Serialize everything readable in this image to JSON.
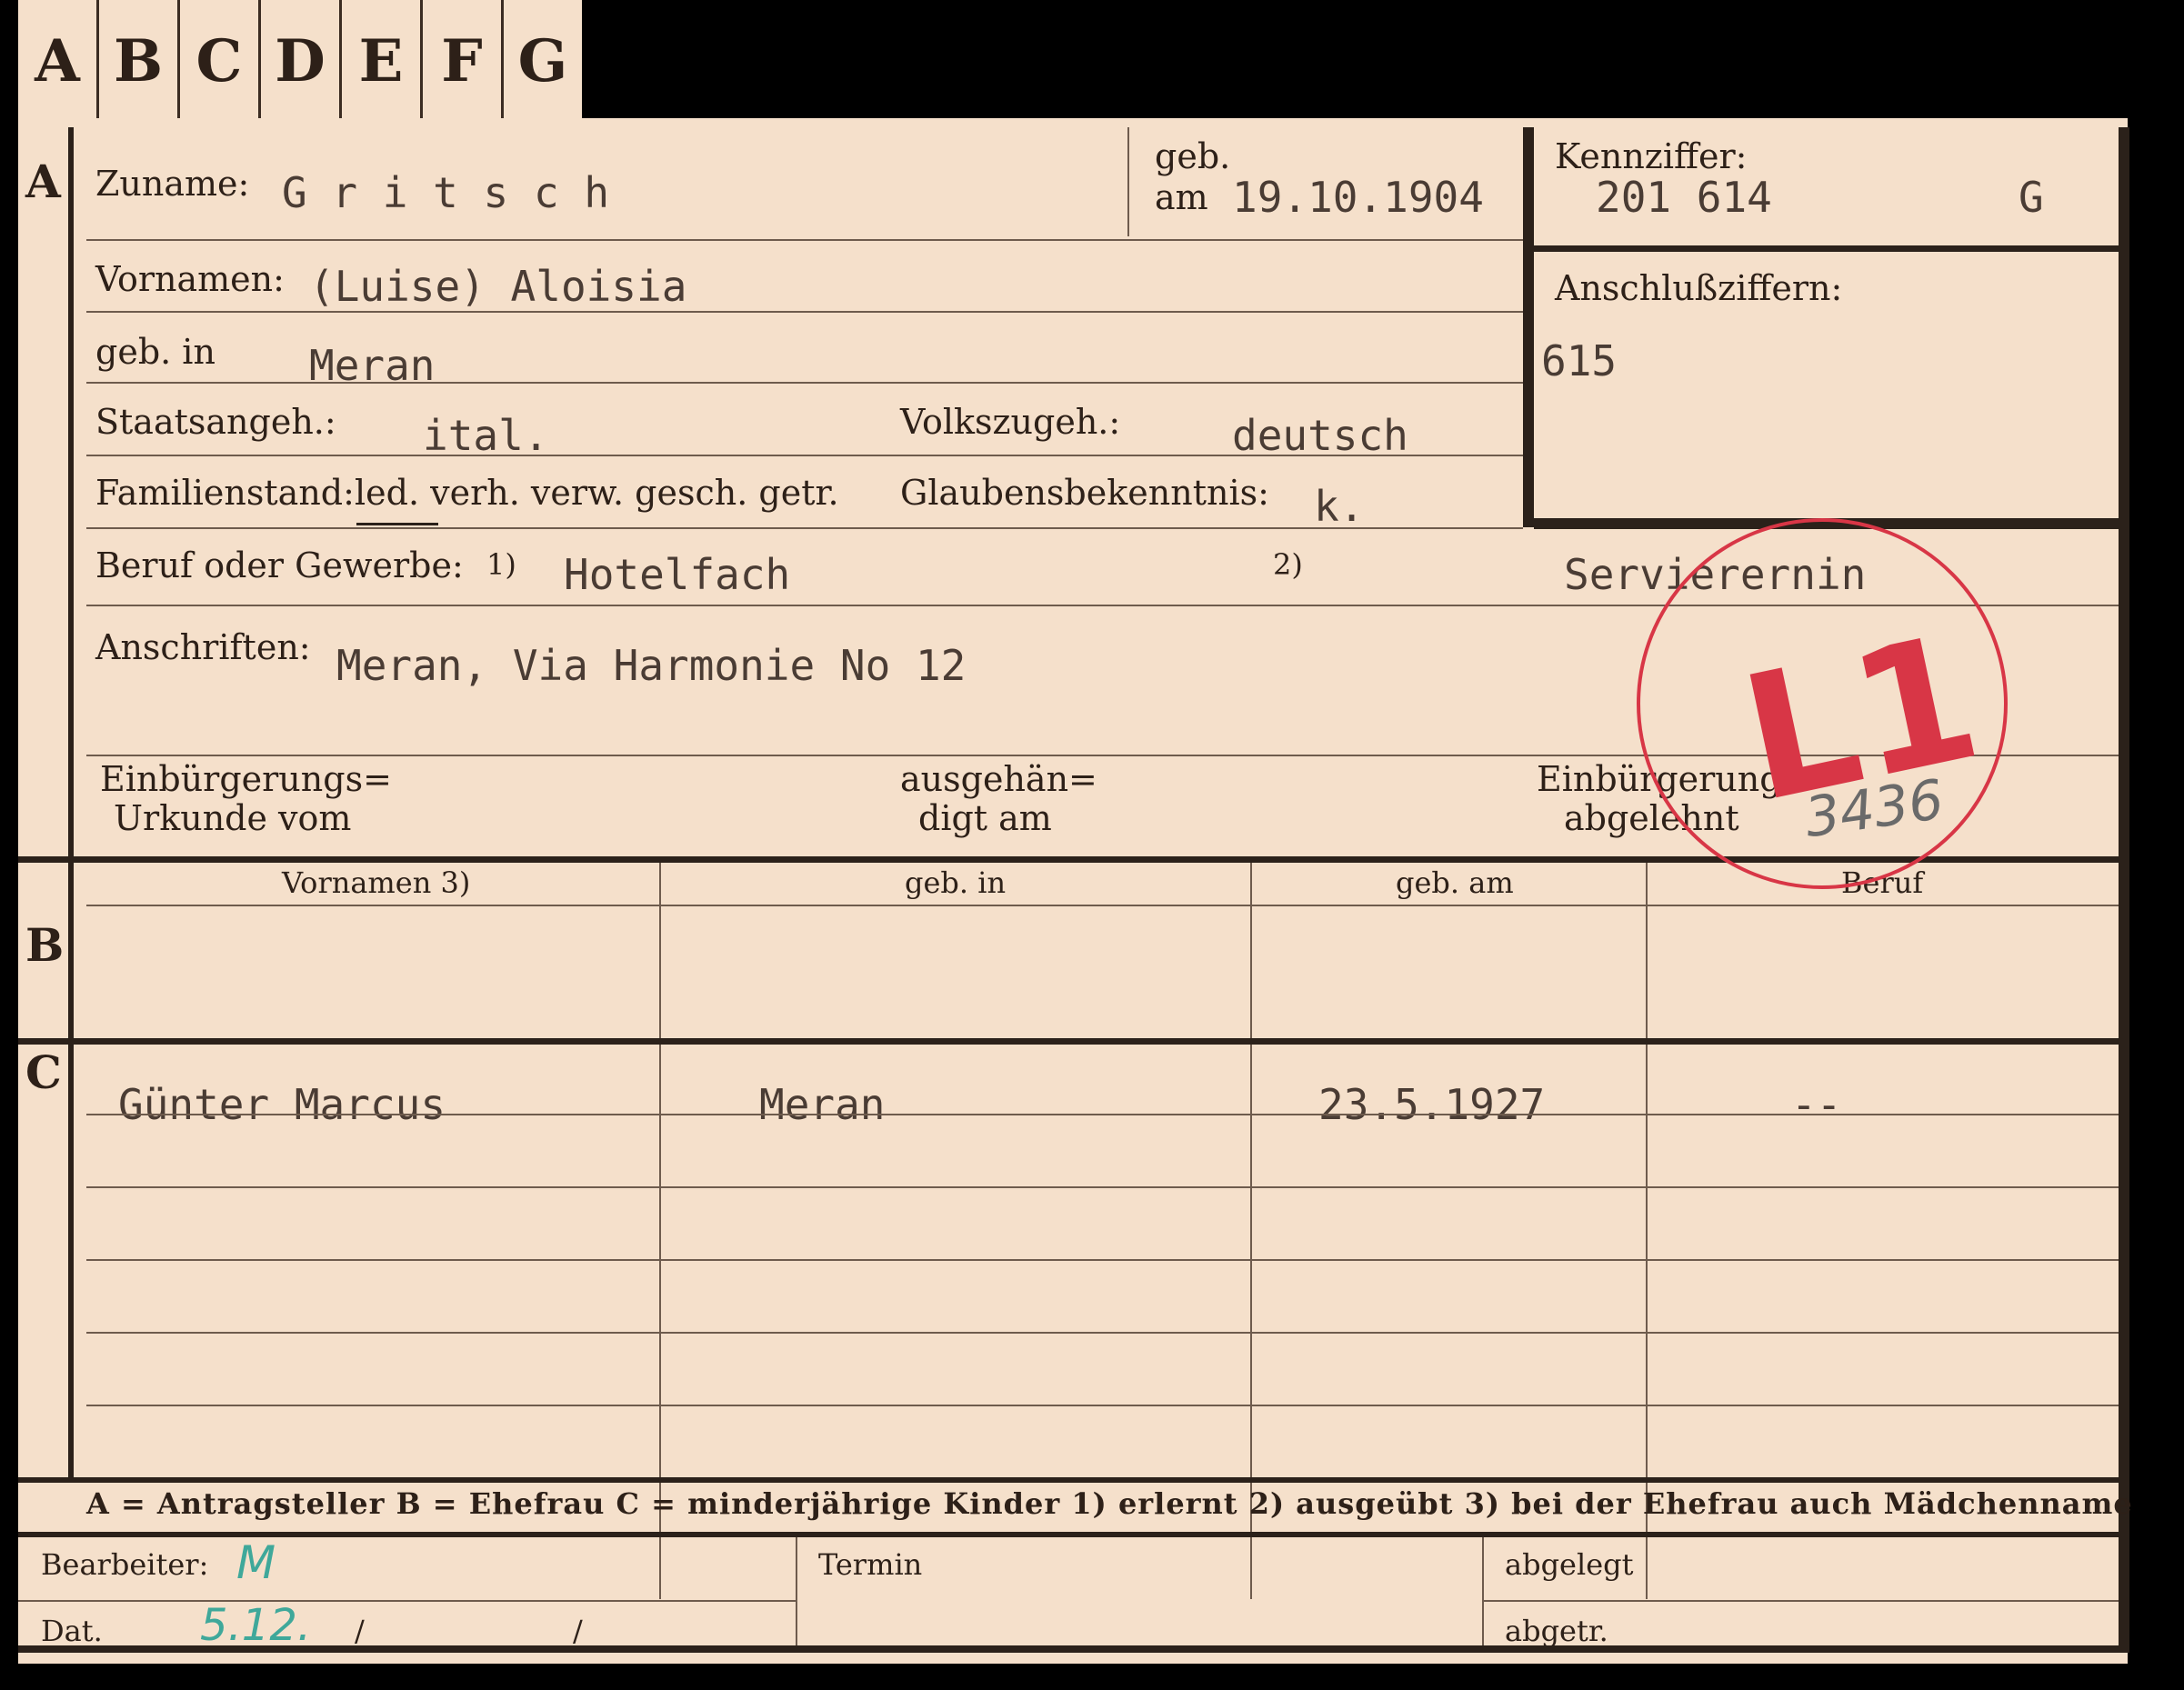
{
  "tabs": [
    "A",
    "B",
    "C",
    "D",
    "E",
    "F",
    "G"
  ],
  "section_letters": {
    "a": "A",
    "b": "B",
    "c": "C"
  },
  "header": {
    "zuname_label": "Zuname:",
    "zuname_value": "G r i t s c h",
    "geb_label": "geb.",
    "am_label": "am",
    "birth_date": "19.10.1904",
    "kennziffer_label": "Kennziffer:",
    "kennziffer_value": "201 614",
    "kennziffer_suffix": "G",
    "anschluss_label": "Anschlußziffern:",
    "anschluss_value": "615"
  },
  "person": {
    "vornamen_label": "Vornamen:",
    "vornamen_value": "(Luise) Aloisia",
    "gebin_label": "geb. in",
    "gebin_value": "Meran",
    "staatsangeh_label": "Staatsangeh.:",
    "staatsangeh_value": "ital.",
    "volkszugeh_label": "Volkszugeh.:",
    "volkszugeh_value": "deutsch",
    "familienstand_label": "Familienstand:",
    "familienstand_options": "led. verh. verw. gesch. getr.",
    "glauben_label": "Glaubensbekenntnis:",
    "glauben_value": "k.",
    "beruf_label": "Beruf oder Gewerbe:",
    "beruf_mark1": "1)",
    "beruf_value1": "Hotelfach",
    "beruf_mark2": "2)",
    "beruf_value2": "Servierernin",
    "anschriften_label": "Anschriften:",
    "anschriften_value": "Meran, Via Harmonie No 12",
    "einb_urkunde_label_1": "Einbürgerungs=",
    "einb_urkunde_label_2": "Urkunde vom",
    "ausgehaendigt_label_1": "ausgehän=",
    "ausgehaendigt_label_2": "digt am",
    "einb_abgelehnt_label_1": "Einbürgerung",
    "einb_abgelehnt_label_2": "abgelehnt"
  },
  "stamp": {
    "text": "L1",
    "number": "3436"
  },
  "table": {
    "columns": [
      "Vornamen 3)",
      "geb. in",
      "geb. am",
      "Beruf"
    ],
    "children": [
      {
        "vornamen": "Günter Marcus",
        "gebin": "Meran",
        "gebam": "23.5.1927",
        "beruf": "--"
      }
    ]
  },
  "legend": "A = Antragsteller   B = Ehefrau   C = minderjährige Kinder   1) erlernt   2) ausgeübt   3) bei der Ehefrau auch Mädchenname",
  "footer": {
    "bearbeiter_label": "Bearbeiter:",
    "bearbeiter_value": "M",
    "dat_label": "Dat.",
    "dat_value": "5.12.",
    "slash1": "/",
    "slash2": "/",
    "termin_label": "Termin",
    "abgelegt_label": "abgelegt",
    "abgetr_label": "abgetr."
  }
}
